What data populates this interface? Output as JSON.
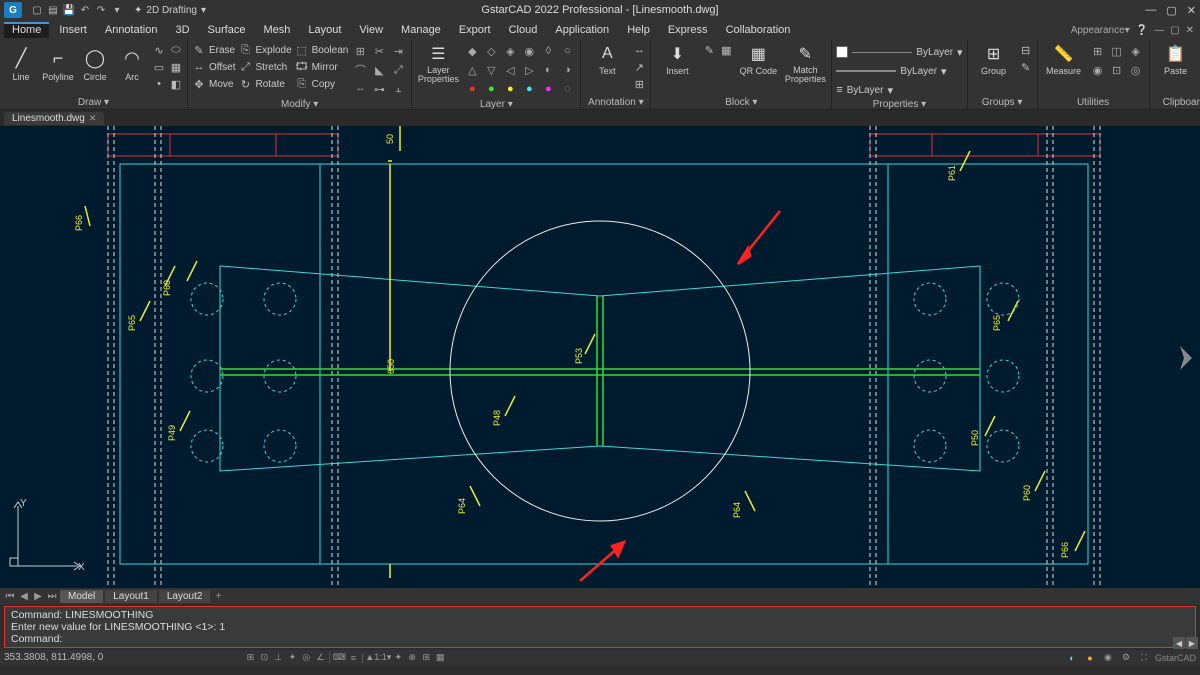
{
  "title": "GstarCAD 2022 Professional - [Linesmooth.dwg]",
  "workspace": "2D Drafting",
  "appearance_label": "Appearance",
  "menu": [
    "Home",
    "Insert",
    "Annotation",
    "3D",
    "Surface",
    "Mesh",
    "Layout",
    "View",
    "Manage",
    "Export",
    "Cloud",
    "Application",
    "Help",
    "Express",
    "Collaboration"
  ],
  "active_menu": "Home",
  "file_tab": "Linesmooth.dwg",
  "panels": {
    "draw": {
      "label": "Draw ▾",
      "tools": [
        "Line",
        "Polyline",
        "Circle",
        "Arc"
      ]
    },
    "modify": {
      "label": "Modify ▾",
      "rows": [
        {
          "icon": "✎",
          "label": "Erase",
          "icon2": "⎘",
          "label2": "Explode",
          "icon3": "⬚",
          "label3": "Boolean"
        },
        {
          "icon": "↔",
          "label": "Offset",
          "icon2": "⤢",
          "label2": "Stretch",
          "icon3": "⮔",
          "label3": "Mirror"
        },
        {
          "icon": "✥",
          "label": "Move",
          "icon2": "↻",
          "label2": "Rotate",
          "icon3": "⎘",
          "label3": "Copy"
        }
      ]
    },
    "layer": {
      "label": "Layer ▾",
      "big": "Layer Properties"
    },
    "annotation": {
      "label": "Annotation ▾",
      "big": "Text"
    },
    "block": {
      "label": "Block ▾",
      "tools": [
        "Insert",
        "QR Code",
        "Match Properties"
      ]
    },
    "properties": {
      "label": "Properties ▾",
      "bylayer": "ByLayer"
    },
    "groups": {
      "label": "Groups ▾",
      "big": "Group"
    },
    "utilities": {
      "label": "Utilities",
      "big": "Measure"
    },
    "clipboard": {
      "label": "Clipboard",
      "big": "Paste"
    }
  },
  "layout_tabs": [
    "Model",
    "Layout1",
    "Layout2"
  ],
  "active_layout": "Model",
  "cmd": {
    "l1": "Command: LINESMOOTHING",
    "l2": "Enter new value for LINESMOOTHING <1>: 1",
    "l3": "Command:"
  },
  "coords": "353.3808, 811.4998, 0",
  "status_right": "GstarCAD",
  "drawing_labels": [
    "P66",
    "P60",
    "P65",
    "P49",
    "P48",
    "P53",
    "P64",
    "P64",
    "P61",
    "P65",
    "P50",
    "P66",
    "P60"
  ],
  "ucs": {
    "x": "X",
    "y": "Y"
  }
}
